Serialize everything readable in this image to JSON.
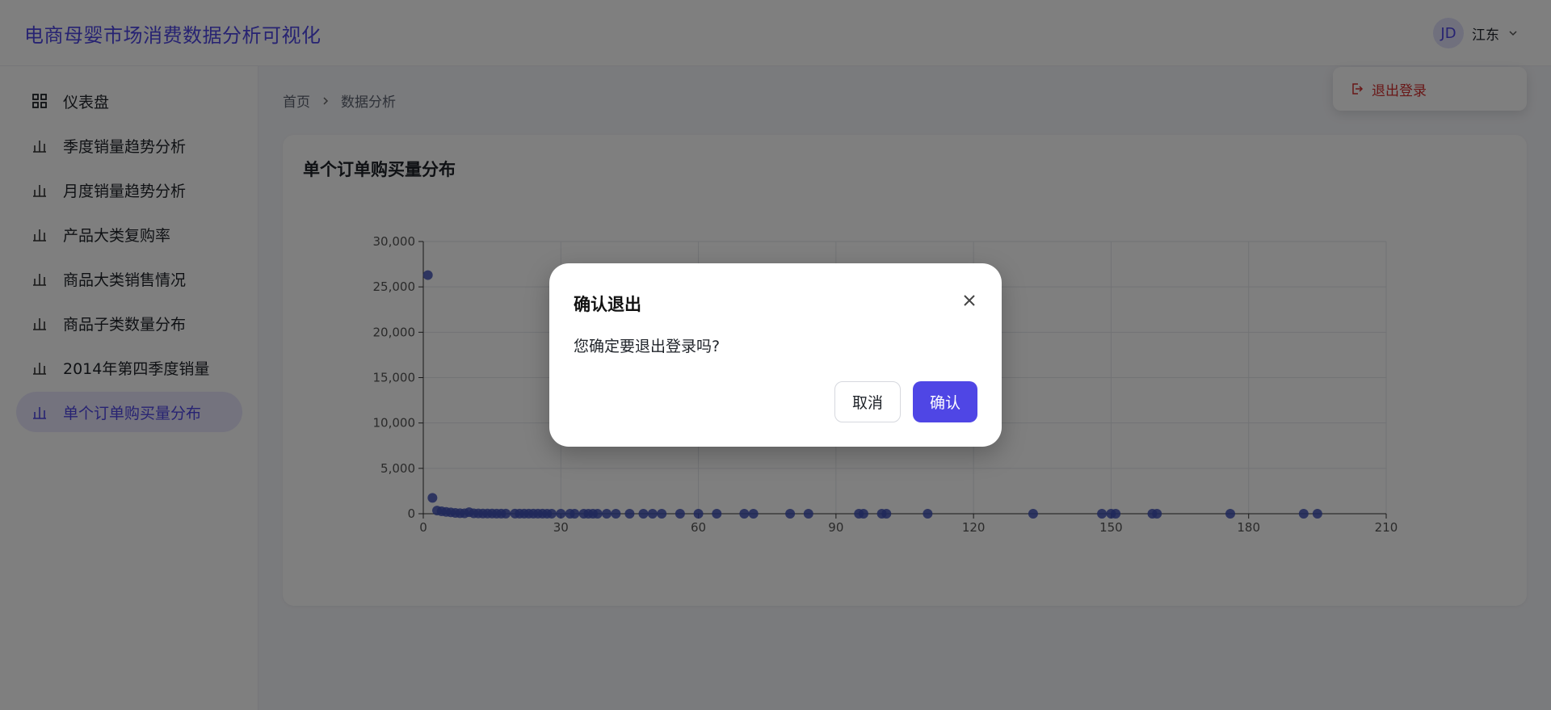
{
  "app": {
    "title": "电商母婴市场消费数据分析可视化"
  },
  "user": {
    "avatar_initials": "JD",
    "name": "江东"
  },
  "dropdown": {
    "logout_label": "退出登录",
    "color": "#d32f2f"
  },
  "sidebar": {
    "items": [
      {
        "label": "仪表盘",
        "icon": "dashboard-grid-icon"
      },
      {
        "label": "季度销量趋势分析",
        "icon": "bar-chart-icon"
      },
      {
        "label": "月度销量趋势分析",
        "icon": "bar-chart-icon"
      },
      {
        "label": "产品大类复购率",
        "icon": "bar-chart-icon"
      },
      {
        "label": "商品大类销售情况",
        "icon": "bar-chart-icon"
      },
      {
        "label": "商品子类数量分布",
        "icon": "bar-chart-icon"
      },
      {
        "label": "2014年第四季度销量",
        "icon": "bar-chart-icon"
      },
      {
        "label": "单个订单购买量分布",
        "icon": "bar-chart-icon",
        "active": true
      }
    ]
  },
  "breadcrumb": {
    "home": "首页",
    "current": "数据分析"
  },
  "card": {
    "title": "单个订单购买量分布"
  },
  "chart_data": {
    "type": "scatter",
    "title": "",
    "xlabel": "",
    "ylabel": "",
    "xlim": [
      0,
      210
    ],
    "ylim": [
      0,
      30000
    ],
    "x_ticks": [
      "0",
      "30",
      "60",
      "90",
      "120",
      "150",
      "180",
      "210"
    ],
    "y_ticks": [
      "0",
      "5,000",
      "10,000",
      "15,000",
      "20,000",
      "25,000",
      "30,000"
    ],
    "grid": true,
    "color": "#3f51b5",
    "points": [
      [
        1,
        26300
      ],
      [
        2,
        1750
      ],
      [
        3,
        350
      ],
      [
        4,
        270
      ],
      [
        5,
        200
      ],
      [
        6,
        150
      ],
      [
        7,
        90
      ],
      [
        8,
        60
      ],
      [
        9,
        40
      ],
      [
        10,
        170
      ],
      [
        11,
        40
      ],
      [
        12,
        30
      ],
      [
        13,
        25
      ],
      [
        14,
        20
      ],
      [
        15,
        20
      ],
      [
        16,
        15
      ],
      [
        17,
        15
      ],
      [
        18,
        12
      ],
      [
        20,
        12
      ],
      [
        21,
        10
      ],
      [
        22,
        10
      ],
      [
        23,
        8
      ],
      [
        24,
        8
      ],
      [
        25,
        6
      ],
      [
        26,
        6
      ],
      [
        27,
        5
      ],
      [
        28,
        5
      ],
      [
        30,
        5
      ],
      [
        32,
        4
      ],
      [
        33,
        4
      ],
      [
        35,
        4
      ],
      [
        36,
        3
      ],
      [
        37,
        3
      ],
      [
        38,
        3
      ],
      [
        40,
        3
      ],
      [
        42,
        3
      ],
      [
        45,
        2
      ],
      [
        48,
        2
      ],
      [
        50,
        2
      ],
      [
        52,
        2
      ],
      [
        56,
        2
      ],
      [
        60,
        2
      ],
      [
        64,
        2
      ],
      [
        70,
        1
      ],
      [
        72,
        1
      ],
      [
        80,
        1
      ],
      [
        84,
        1
      ],
      [
        95,
        1
      ],
      [
        96,
        1
      ],
      [
        100,
        1
      ],
      [
        101,
        1
      ],
      [
        110,
        1
      ],
      [
        133,
        1
      ],
      [
        148,
        1
      ],
      [
        150,
        1
      ],
      [
        151,
        1
      ],
      [
        159,
        1
      ],
      [
        160,
        1
      ],
      [
        176,
        1
      ],
      [
        192,
        1
      ],
      [
        195,
        1
      ]
    ]
  },
  "modal": {
    "title": "确认退出",
    "message": "您确定要退出登录吗?",
    "cancel_label": "取消",
    "confirm_label": "确认",
    "confirm_color": "#4f46e5"
  }
}
